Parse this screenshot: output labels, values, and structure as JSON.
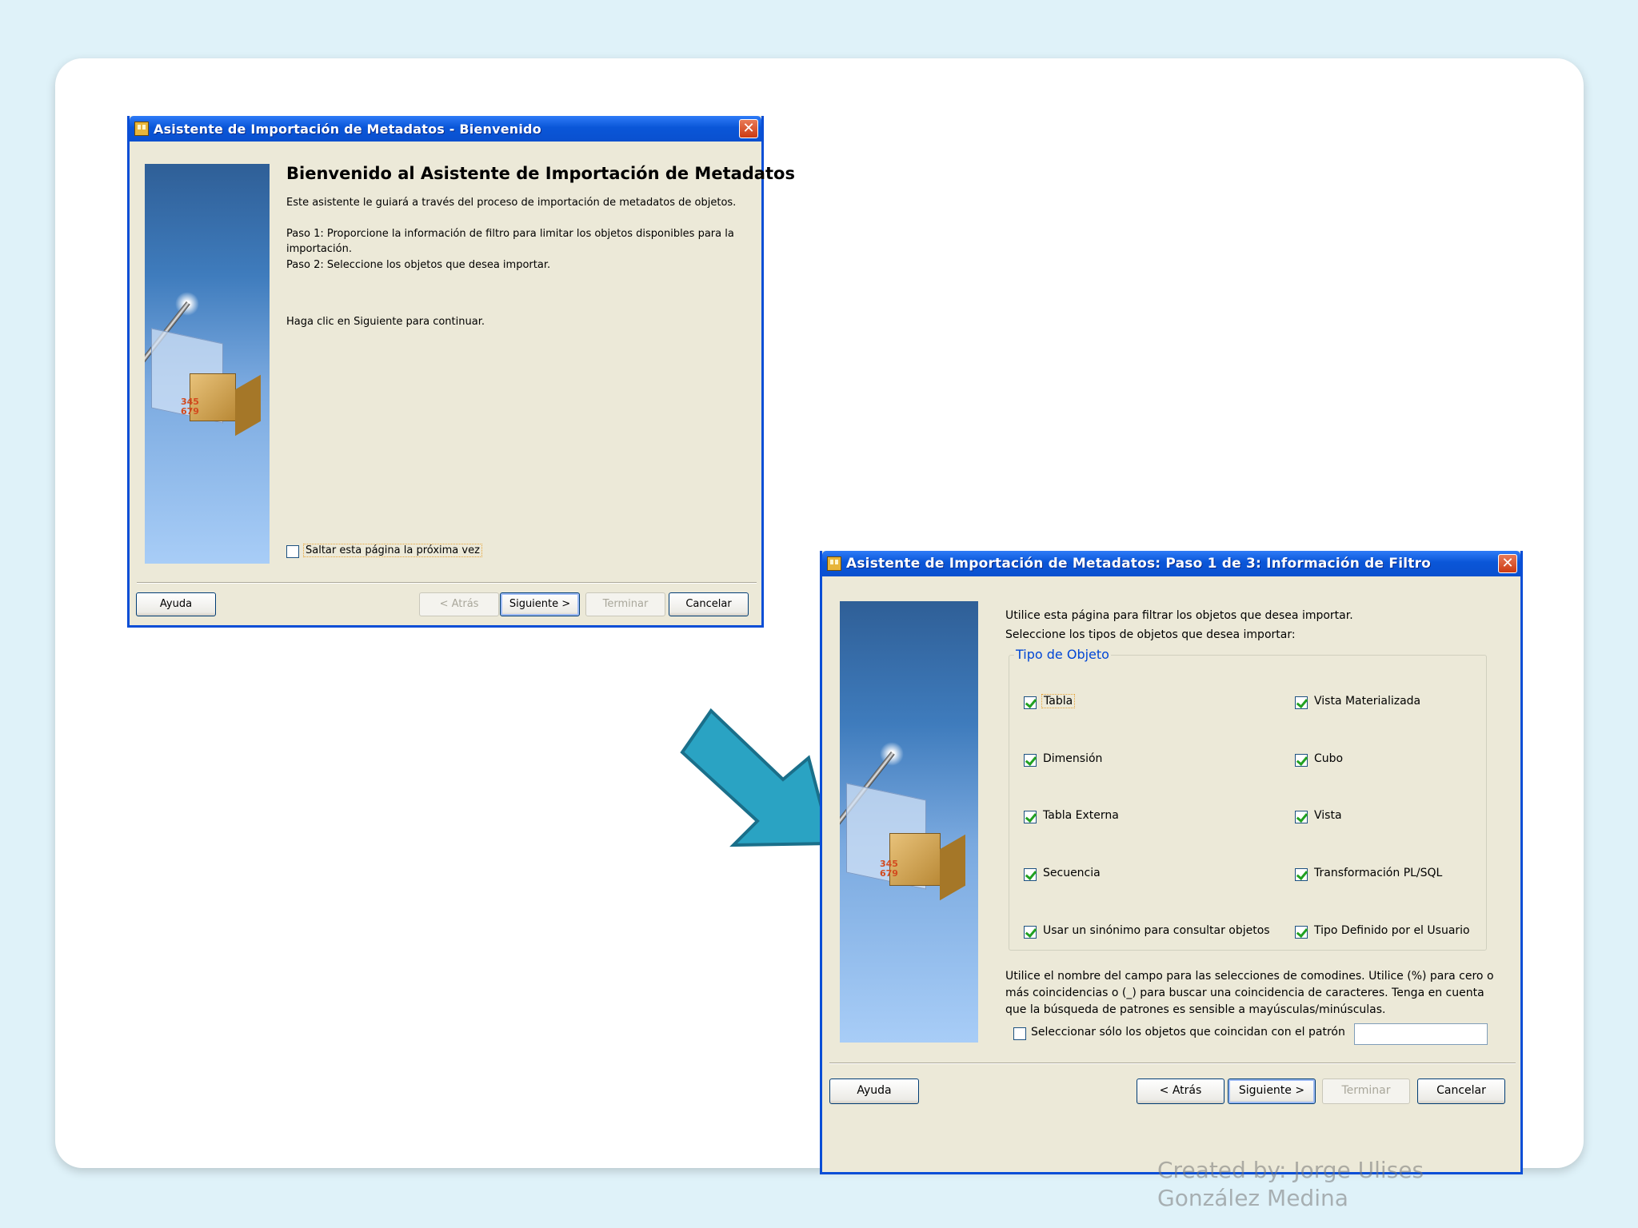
{
  "win1": {
    "title": "Asistente de Importación de Metadatos - Bienvenido",
    "close_glyph": "✕",
    "heading": "Bienvenido al Asistente de Importación de Metadatos",
    "intro": "Este asistente le guiará a través del proceso de importación de metadatos de objetos.",
    "step1_line1": "Paso 1: Proporcione la información de filtro para limitar los objetos disponibles para la",
    "step1_line2": "importación.",
    "step2": "Paso 2: Seleccione los objetos que desea importar.",
    "continue": "Haga clic en Siguiente para continuar.",
    "skip_label": "Saltar esta página la próxima vez",
    "buttons": {
      "help": "Ayuda",
      "back": "< Atrás",
      "next": "Siguiente >",
      "finish": "Terminar",
      "cancel": "Cancelar"
    },
    "image_digits": "345\n679"
  },
  "win2": {
    "title": "Asistente de Importación de Metadatos: Paso 1 de 3: Información de Filtro",
    "close_glyph": "✕",
    "line1": "Utilice esta página para filtrar los objetos que desea importar.",
    "line2": "Seleccione los tipos de objetos que desea importar:",
    "group_title": "Tipo de Objeto",
    "checkboxes": [
      {
        "label": "Tabla",
        "checked": true
      },
      {
        "label": "Vista Materializada",
        "checked": true
      },
      {
        "label": "Dimensión",
        "checked": true
      },
      {
        "label": "Cubo",
        "checked": true
      },
      {
        "label": "Tabla Externa",
        "checked": true
      },
      {
        "label": "Vista",
        "checked": true
      },
      {
        "label": "Secuencia",
        "checked": true
      },
      {
        "label": "Transformación PL/SQL",
        "checked": true
      },
      {
        "label": "Usar un sinónimo para consultar objetos",
        "checked": true
      },
      {
        "label": "Tipo Definido por el Usuario",
        "checked": true
      }
    ],
    "wildcard_line1": "Utilice el nombre del campo para las selecciones de comodines. Utilice (%) para cero o",
    "wildcard_line2": "más coincidencias o (_) para buscar una coincidencia de caracteres. Tenga en cuenta",
    "wildcard_line3": "que la búsqueda de patrones es sensible a mayúsculas/minúsculas.",
    "pattern_label": "Seleccionar sólo los objetos que coincidan con el patrón",
    "pattern_value": "",
    "buttons": {
      "help": "Ayuda",
      "back": "< Atrás",
      "next": "Siguiente >",
      "finish": "Terminar",
      "cancel": "Cancelar"
    },
    "image_digits": "345\n679"
  },
  "watermark_line1": "Created by: Jorge Ulises",
  "watermark_line2": "González Medina",
  "colors": {
    "arrow": "#2aa3c3",
    "arrow_stroke": "#1a6f8a",
    "titlebar": "#0a56d8"
  }
}
